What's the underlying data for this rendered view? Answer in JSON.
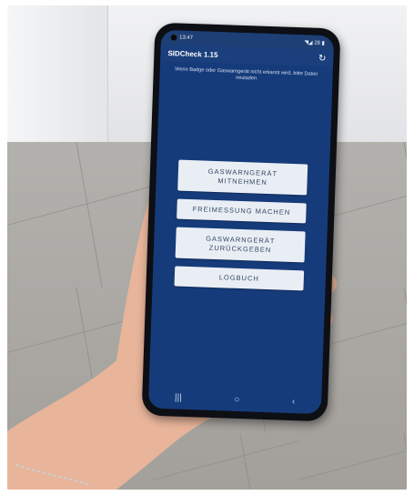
{
  "status_bar": {
    "time": "13:47",
    "right": "◥◢ 28 ▮"
  },
  "app_bar": {
    "title": "SIDCheck 1.15",
    "refresh_icon": "refresh-icon"
  },
  "hint_text": "Wenn Badge oder Gaswarngerät nicht erkannt wird, bitte Daten neuladen",
  "buttons": [
    {
      "line1": "GASWARNGERÄT",
      "line2": "MITNEHMEN"
    },
    {
      "line1": "FREIMESSUNG MACHEN",
      "line2": ""
    },
    {
      "line1": "GASWARNGERÄT",
      "line2": "ZURÜCKGEBEN"
    },
    {
      "line1": "LOGBUCH",
      "line2": ""
    }
  ],
  "nav_bar": {
    "recents": "|||",
    "home": "○",
    "back": "‹"
  },
  "colors": {
    "screen_bg": "#163b7a",
    "button_bg": "#e9eef5",
    "button_text": "#34445e"
  }
}
